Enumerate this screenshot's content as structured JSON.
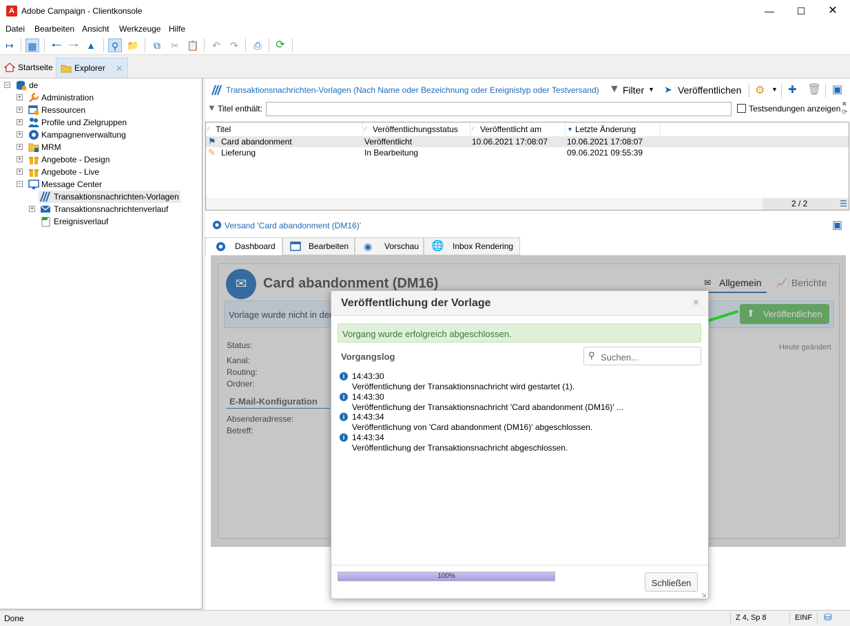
{
  "window": {
    "title": "Adobe Campaign - Clientkonsole",
    "app_icon_letter": "A"
  },
  "menu": [
    "Datei",
    "Bearbeiten",
    "Ansicht",
    "Werkzeuge",
    "Hilfe"
  ],
  "tabs": {
    "home": "Startseite",
    "explorer": "Explorer"
  },
  "tree": {
    "root": "de",
    "items": [
      {
        "label": "Administration",
        "icon": "wrench-icon"
      },
      {
        "label": "Ressourcen",
        "icon": "resources-icon"
      },
      {
        "label": "Profile und Zielgruppen",
        "icon": "people-icon"
      },
      {
        "label": "Kampagnenverwaltung",
        "icon": "campaign-icon"
      },
      {
        "label": "MRM",
        "icon": "folder-icon"
      },
      {
        "label": "Angebote - Design",
        "icon": "gift-icon"
      },
      {
        "label": "Angebote - Live",
        "icon": "gift-icon"
      },
      {
        "label": "Message Center",
        "icon": "monitor-icon"
      }
    ],
    "children": [
      {
        "label": "Transaktionsnachrichten-Vorlagen",
        "icon": "template-icon"
      },
      {
        "label": "Transaktionsnachrichtenverlauf",
        "icon": "envelope-icon"
      },
      {
        "label": "Ereignisverlauf",
        "icon": "event-icon"
      }
    ]
  },
  "list": {
    "title": "Transaktionsnachrichten-Vorlagen (Nach Name oder Bezeichnung oder Ereignistyp oder Testversand)",
    "filter_label": "Filter",
    "publish_label": "Veröffentlichen",
    "filter_field_label": "Titel enthält:",
    "filter_value": "",
    "test_checkbox_label": "Testsendungen anzeigen",
    "columns": [
      "Titel",
      "Veröffentlichungsstatus",
      "Veröffentlicht am",
      "Letzte Änderung"
    ],
    "rows": [
      {
        "title": "Card abandonment",
        "status": "Veröffentlicht",
        "published": "10.06.2021 17:08:07",
        "modified": "10.06.2021 17:08:07",
        "icon": "delivery-published-icon"
      },
      {
        "title": "Lieferung",
        "status": "In Bearbeitung",
        "published": "",
        "modified": "09.06.2021 09:55:39",
        "icon": "pencil-icon"
      }
    ],
    "count": "2 / 2"
  },
  "detail": {
    "header": "Versand 'Card abandonment (DM16)'",
    "tabs": [
      "Dashboard",
      "Bearbeiten",
      "Vorschau",
      "Inbox Rendering"
    ],
    "name": "Card abandonment (DM16)",
    "tab_general": "Allgemein",
    "tab_reports": "Berichte",
    "banner_text": "Vorlage wurde nicht in der",
    "publish_button": "Veröffentlichen",
    "changed_text": "Heute geändert",
    "fields": [
      "Status:",
      "Kanal:",
      "Routing:",
      "Ordner:"
    ],
    "email_section": "E-Mail-Konfiguration",
    "email_fields": [
      "Absenderadresse:",
      "Betreff:"
    ]
  },
  "dialog": {
    "title": "Veröffentlichung der Vorlage",
    "success": "Vorgang wurde erfolgreich abgeschlossen.",
    "log_title": "Vorgangslog",
    "search_placeholder": "Suchen...",
    "log": [
      {
        "time": "14:43:30",
        "text": "Veröffentlichung der Transaktionsnachricht wird gestartet (1)."
      },
      {
        "time": "14:43:30",
        "text": "Veröffentlichung der Transaktionsnachricht 'Card abandonment (DM16)' ..."
      },
      {
        "time": "14:43:34",
        "text": "Veröffentlichung von 'Card abandonment (DM16)' abgeschlossen."
      },
      {
        "time": "14:43:34",
        "text": "Veröffentlichung der Transaktionsnachricht abgeschlossen."
      }
    ],
    "progress_label": "100%",
    "progress": 1.0,
    "close_button": "Schließen"
  },
  "status": {
    "left": "Done",
    "position": "Z 4, Sp 8",
    "mode": "EINF"
  },
  "colors": {
    "accent_blue": "#1f6ab5",
    "success_bg": "#dff0d8",
    "publish_green": "#5cb85c",
    "arrow_green": "#22cc22",
    "progress_fill": "#b0a8e8"
  }
}
